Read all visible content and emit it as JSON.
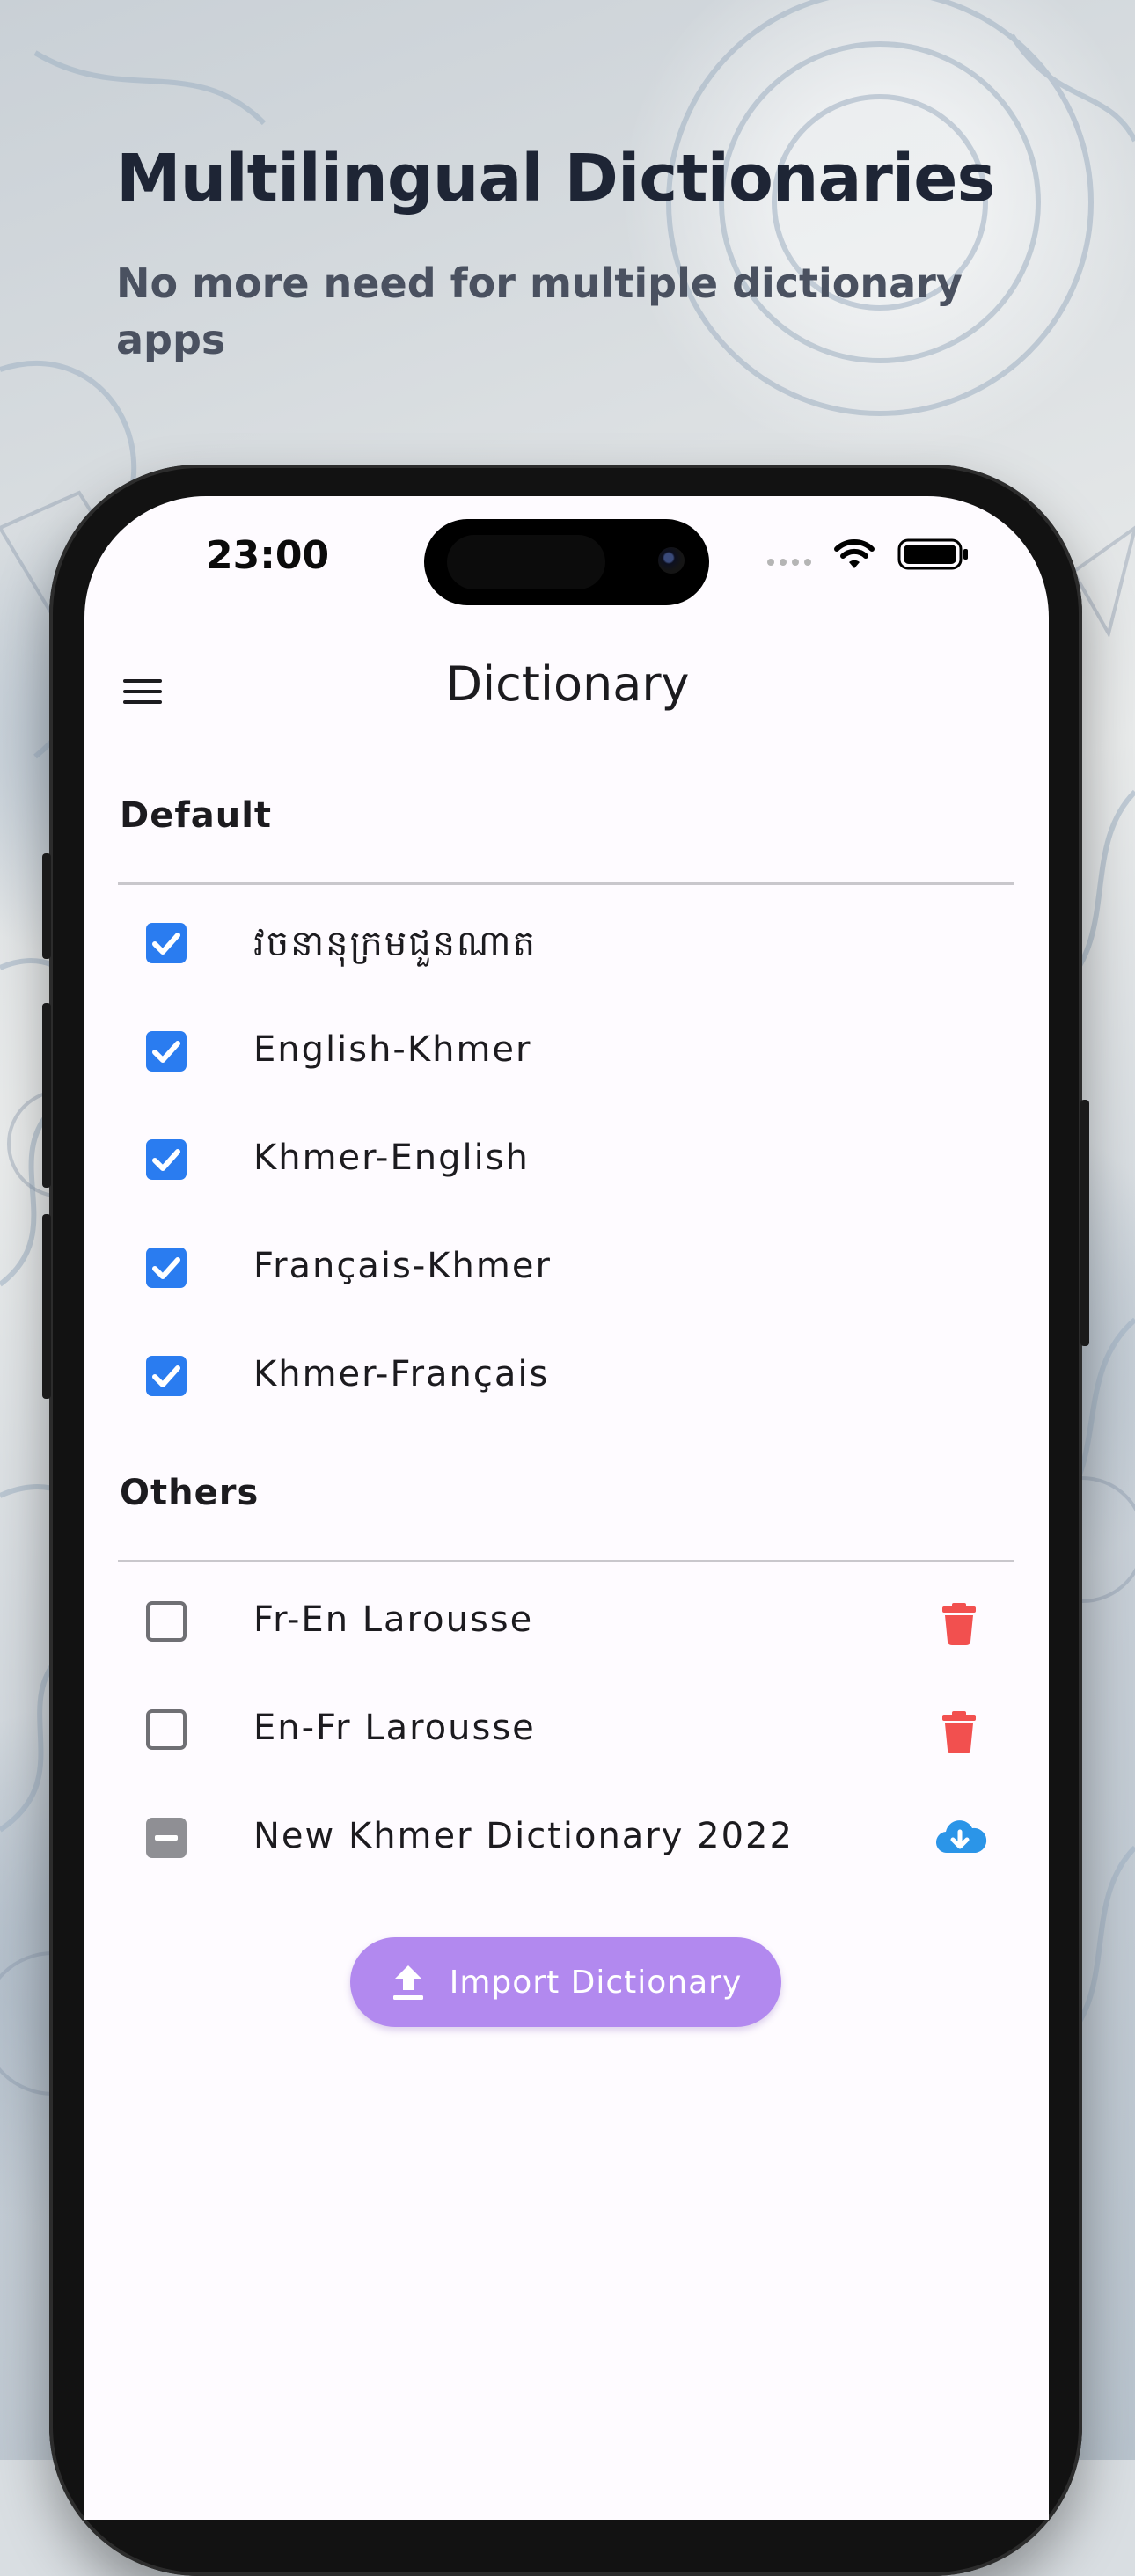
{
  "headline": "Multilingual Dictionaries",
  "subline": "No more need for multiple dictionary apps",
  "status_bar": {
    "time": "23:00",
    "icons": [
      "signal-dots-icon",
      "wifi-icon",
      "battery-icon"
    ]
  },
  "app_bar": {
    "menu_icon": "menu-icon",
    "title": "Dictionary"
  },
  "sections": {
    "default": {
      "title": "Default",
      "items": [
        {
          "label": "វចនានុក្រមជួនណាត",
          "state": "checked"
        },
        {
          "label": "English-Khmer",
          "state": "checked"
        },
        {
          "label": "Khmer-English",
          "state": "checked"
        },
        {
          "label": "Français-Khmer",
          "state": "checked"
        },
        {
          "label": "Khmer-Français",
          "state": "checked"
        }
      ]
    },
    "others": {
      "title": "Others",
      "items": [
        {
          "label": "Fr-En Larousse",
          "state": "unchecked",
          "action": "delete-icon"
        },
        {
          "label": "En-Fr Larousse",
          "state": "unchecked",
          "action": "delete-icon"
        },
        {
          "label": "New Khmer Dictionary 2022",
          "state": "indeterminate",
          "action": "cloud-download-icon"
        }
      ]
    }
  },
  "import_button": {
    "label": "Import Dictionary",
    "icon": "upload-icon"
  },
  "colors": {
    "checkbox_checked": "#2a7cf0",
    "checkbox_indeterminate": "#8f8f94",
    "delete_icon": "#f2504f",
    "download_icon": "#2b95e8",
    "import_button": "#b289ef",
    "headline": "#1e2535",
    "subline": "#4a5160"
  }
}
